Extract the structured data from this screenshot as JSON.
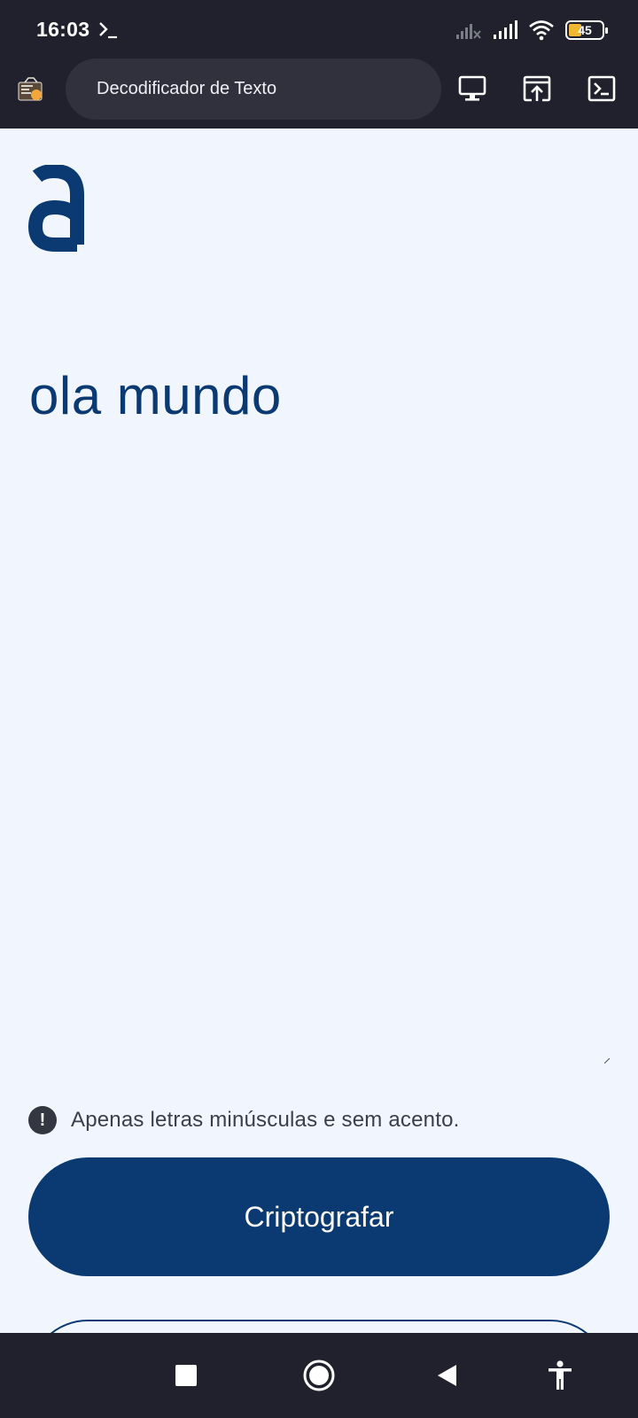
{
  "status_bar": {
    "time": "16:03",
    "battery_level": "45",
    "icons": [
      "terminal-prompt-icon",
      "signal-off-icon",
      "signal-icon",
      "wifi-icon",
      "battery-icon"
    ]
  },
  "app_bar": {
    "title": "Decodificador de Texto",
    "actions": [
      "desktop-icon",
      "open-in-browser-icon",
      "terminal-icon"
    ]
  },
  "main": {
    "message": "ola mundo"
  },
  "hint": {
    "icon": "alert-icon",
    "text": "Apenas letras minúsculas e sem acento."
  },
  "buttons": {
    "encrypt_label": "Criptografar"
  },
  "nav_bar": {
    "icons": [
      "recents-icon",
      "home-icon",
      "back-icon",
      "accessibility-icon"
    ]
  },
  "colors": {
    "primary": "#0b3a72",
    "background": "#f1f5fe",
    "system_bar": "#20212c",
    "battery": "#f1b733"
  }
}
